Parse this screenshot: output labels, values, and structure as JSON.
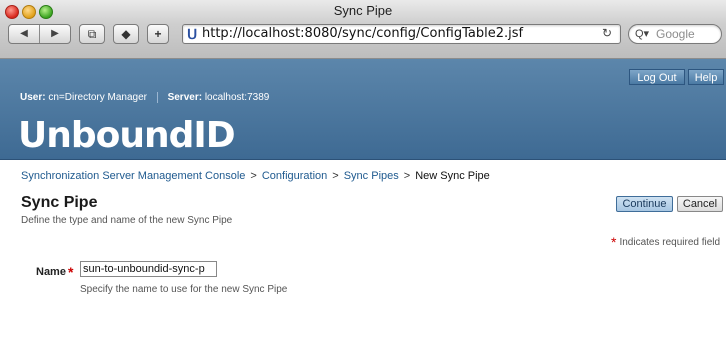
{
  "window": {
    "title": "Sync Pipe"
  },
  "browser": {
    "url": "http://localhost:8080/sync/config/ConfigTable2.jsf",
    "search_placeholder": "Google",
    "add_label": "+"
  },
  "header": {
    "user_label": "User:",
    "user_value": "cn=Directory Manager",
    "server_label": "Server:",
    "server_value": "localhost:7389",
    "logout": "Log Out",
    "help": "Help",
    "logo": "UnboundID"
  },
  "breadcrumb": {
    "items": [
      "Synchronization Server Management Console",
      "Configuration",
      "Sync Pipes"
    ],
    "current": "New Sync Pipe",
    "separator": ">"
  },
  "page": {
    "title": "Sync Pipe",
    "description": "Define the type and name of the new Sync Pipe",
    "continue": "Continue",
    "cancel": "Cancel",
    "required_note": "Indicates required field",
    "required_marker": "*"
  },
  "form": {
    "name_label": "Name",
    "name_value": "sun-to-unboundid-sync-p",
    "name_help": "Specify the name to use for the new Sync Pipe"
  },
  "colors": {
    "header_bg": "#4a7aa3",
    "link": "#1f5a8f",
    "required": "#cc0000"
  }
}
